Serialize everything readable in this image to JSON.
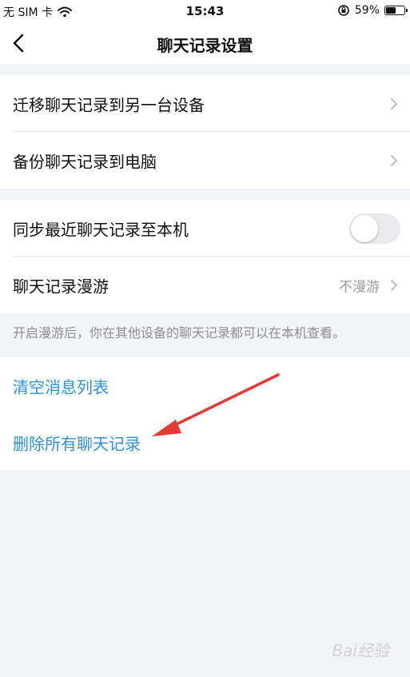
{
  "status_bar": {
    "carrier": "无 SIM 卡",
    "time": "15:43",
    "battery": "59%",
    "battery_level": 0.59
  },
  "nav": {
    "title": "聊天记录设置"
  },
  "group1": {
    "items": [
      {
        "label": "迁移聊天记录到另一台设备"
      },
      {
        "label": "备份聊天记录到电脑"
      }
    ]
  },
  "group2": {
    "sync": {
      "label": "同步最近聊天记录至本机",
      "on": false
    },
    "roaming": {
      "label": "聊天记录漫游",
      "value": "不漫游"
    },
    "hint": "开启漫游后，你在其他设备的聊天记录都可以在本机查看。"
  },
  "group3": {
    "clear_list": "清空消息列表",
    "delete_all": "删除所有聊天记录"
  },
  "colors": {
    "accent": "#2f8fd6",
    "background": "#f2f3f7",
    "annotation_arrow": "#e53935"
  },
  "watermark": "Bai经验"
}
